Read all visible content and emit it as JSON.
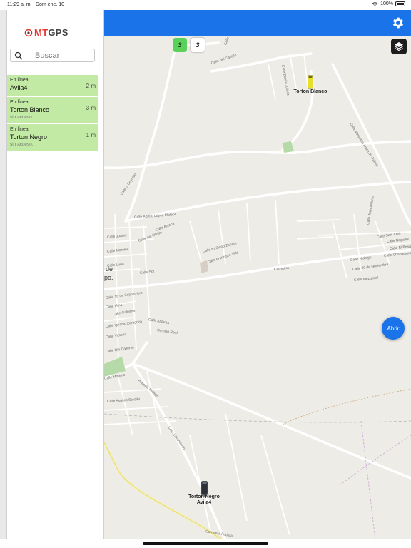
{
  "status_bar": {
    "time": "11:29 a. m.",
    "date": "Dom ene. 10",
    "battery": "100%"
  },
  "brand": {
    "mt": "MT",
    "gps": "GPS",
    "accent": "#e53935"
  },
  "search": {
    "placeholder": "Buscar",
    "value": ""
  },
  "vehicles": [
    {
      "status": "En línea",
      "name": "Avila4",
      "ago": "2 m",
      "note": ""
    },
    {
      "status": "En línea",
      "name": "Torton Blanco",
      "ago": "3 m",
      "note": "sin acceso.."
    },
    {
      "status": "En línea",
      "name": "Torton Negro",
      "ago": "1 m",
      "note": "sin acceso.."
    }
  ],
  "map": {
    "clusters": [
      {
        "count": "3",
        "color": "#5ad15a"
      },
      {
        "count": "3",
        "color": "#ffffff"
      }
    ],
    "markers": [
      {
        "label": "Torton Blanco"
      },
      {
        "label": "Torton Negro"
      },
      {
        "label": "Avila4"
      }
    ],
    "streets": [
      "Calle del Castillo",
      "Calle Zapata",
      "Calle Benito Juárez",
      "Calle Margarita Maza de Juárez",
      "Calle 5 Coyotillo",
      "Calle Adolfo López Mateos",
      "Calle Emiliano Zapata",
      "Calle Francisco Villa",
      "Carretera",
      "Calle Juan Aldama",
      "Calle San Juan",
      "Calle Hidalgo",
      "Calle 20 de Noviembre",
      "Calle Mezquital",
      "Calle Aldama",
      "Camino Real",
      "Calle Galeana",
      "Calle Aquiles Serdán",
      "Calle Libramiento",
      "Carretera Federal",
      "Calle El Bosque",
      "Calle Nogales",
      "Calle Chabacano",
      "Calle Moreno",
      "Avenida Hidalgo",
      "Calle Ignacio Zaragoza",
      "Calle Morelos",
      "Calle Mina",
      "Calle Victoria",
      "Calle Juárez",
      "Calle Luna",
      "Calle Sol",
      "Calle Azteca",
      "Calle del Olvido",
      "Calle 16 de Septiembre",
      "Calle Ojo Caliente"
    ],
    "place_fragments": [
      "de",
      "po."
    ]
  },
  "actions": {
    "open_label": "Abrir"
  },
  "colors": {
    "header": "#1a73e8",
    "row_bg": "#c3eaa4",
    "map_bg": "#eeece6"
  }
}
